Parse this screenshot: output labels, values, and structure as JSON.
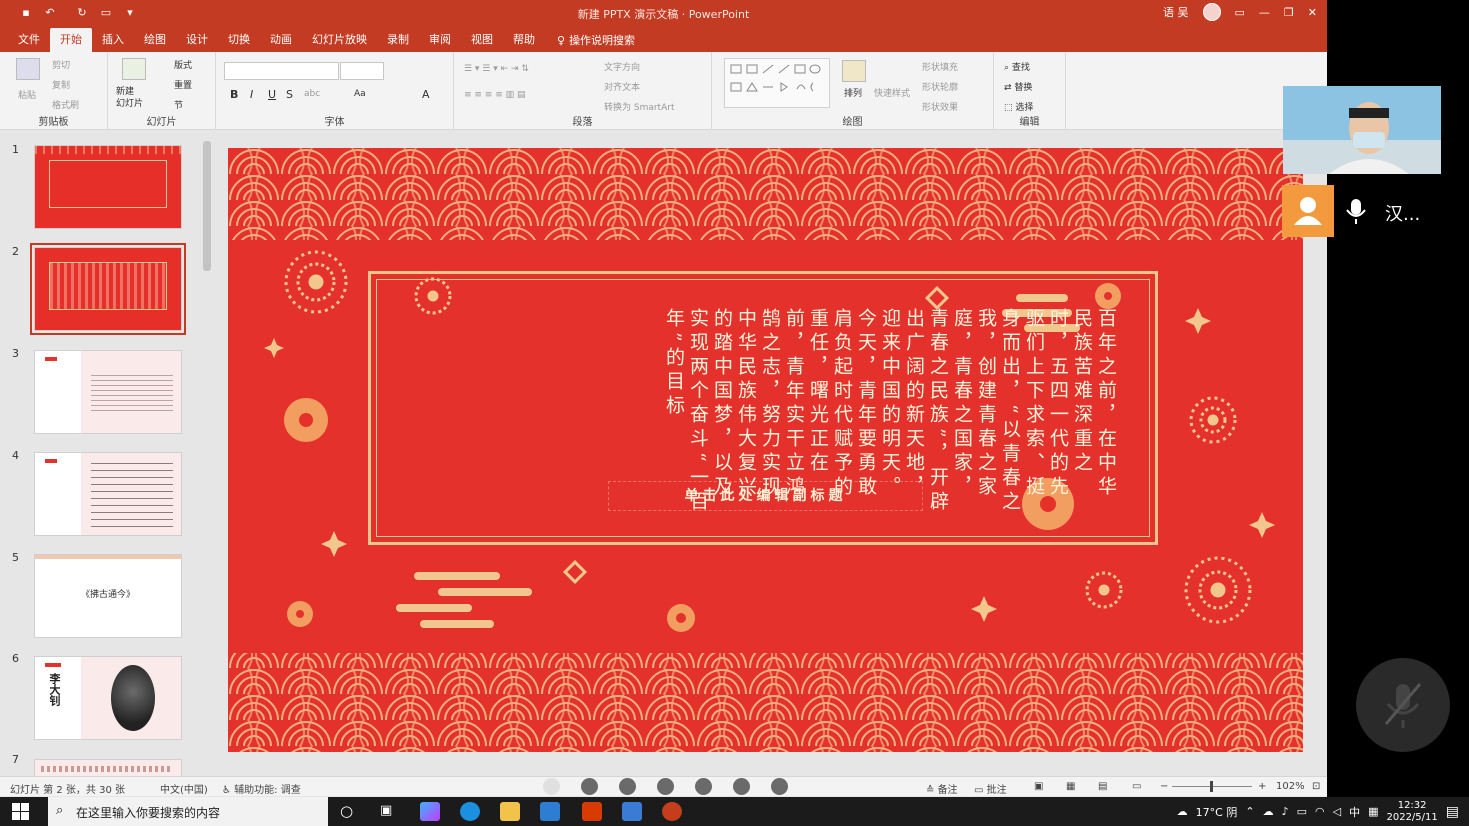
{
  "titlebar": {
    "title": "新建 PPTX 演示文稿 · PowerPoint",
    "user_label": "语 吴",
    "quick_access": [
      "save-icon",
      "undo-icon",
      "redo-icon",
      "present-icon",
      "customize-icon"
    ]
  },
  "tabs": [
    "文件",
    "开始",
    "插入",
    "绘图",
    "设计",
    "切换",
    "动画",
    "幻灯片放映",
    "录制",
    "审阅",
    "视图",
    "帮助"
  ],
  "active_tab": "开始",
  "tell_me": "操作说明搜索",
  "ribbon": {
    "clipboard": {
      "label": "剪贴板",
      "paste": "粘贴",
      "cut": "剪切",
      "copy": "复制",
      "format_painter": "格式刷"
    },
    "slides": {
      "label": "幻灯片",
      "new_slide": "新建\n幻灯片",
      "layout": "版式",
      "reset": "重置",
      "section": "节"
    },
    "font": {
      "label": "字体",
      "bold": "B",
      "italic": "I",
      "underline": "U",
      "strike": "S",
      "shadow": "abc",
      "case": "Aa",
      "color": "A"
    },
    "paragraph": {
      "label": "段落",
      "text_direction": "文字方向",
      "align_text": "对齐文本",
      "smartart": "转换为 SmartArt"
    },
    "drawing": {
      "label": "绘图",
      "arrange": "排列",
      "quick_styles": "快速样式",
      "fill": "形状填充",
      "outline": "形状轮廓",
      "effects": "形状效果"
    },
    "editing": {
      "label": "编辑",
      "find": "查找",
      "replace": "替换",
      "select": "选择"
    }
  },
  "thumbnails": [
    {
      "num": "1",
      "style": "red"
    },
    {
      "num": "2",
      "style": "red"
    },
    {
      "num": "3",
      "style": "pink"
    },
    {
      "num": "4",
      "style": "pink"
    },
    {
      "num": "5",
      "style": "pink",
      "text": "《拂古通今》"
    },
    {
      "num": "6",
      "style": "pink",
      "text": "李大钊"
    },
    {
      "num": "7",
      "style": "pink"
    }
  ],
  "slide": {
    "body_text": "百年之前，在中华民族苦难深重之时，五四一代的先驱们上下求索、挺身而出，“以青春之我，创建青春之家庭，青春之国家，青春之民族”，开辟出广阔的新天地，迎来中国的明天。今天，青年要勇敢肩负起时代赋予的重任，曙光正在前，青年实干立鸿鹄之志，努力实现中华民族伟大复兴的踏中国梦，以及实现两个奋斗“一百年”的目标",
    "subtitle": "单击此处编辑副标题",
    "colors": {
      "background": "#e5312b",
      "gold": "#f2c78e",
      "text": "#fff3dc"
    }
  },
  "statusbar": {
    "slide_info": "幻灯片 第 2 张，共 30 张",
    "language": "中文(中国)",
    "accessibility": "辅助功能: 调查",
    "notes": "备注",
    "comments": "批注",
    "zoom": "102%"
  },
  "taskbar": {
    "search_placeholder": "在这里输入你要搜索的内容",
    "weather": "17°C 阴",
    "ime": "中",
    "time": "12:32",
    "date": "2022/5/11"
  },
  "call": {
    "participant_name": "汉..."
  }
}
